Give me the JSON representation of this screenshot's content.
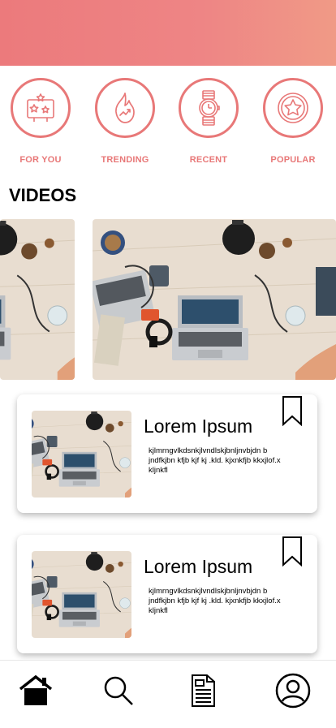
{
  "categories": [
    {
      "label": "FOR YOU",
      "icon": "stars-board-icon"
    },
    {
      "label": "TRENDING",
      "icon": "flame-trend-icon"
    },
    {
      "label": "RECENT",
      "icon": "watch-icon"
    },
    {
      "label": "POPULAR",
      "icon": "star-medal-icon"
    }
  ],
  "section": {
    "title": "VIDEOS"
  },
  "cards": [
    {
      "title": "Lorem Ipsum",
      "description": "kjlmrngvlkdsnkjlvndlskjbnljnvbjdn b jndfkjbn kfjb kjf kj .kld. kjxnkfjb kkxjlof.x kljnkfl"
    },
    {
      "title": "Lorem Ipsum",
      "description": "kjlmrngvlkdsnkjlvndlskjbnljnvbjdn b jndfkjbn kfjb kjf kj .kld. kjxnkfjb kkxjlof.x kljnkfl"
    }
  ],
  "nav": {
    "items": [
      "home-icon",
      "search-icon",
      "document-icon",
      "profile-icon"
    ]
  },
  "colors": {
    "accent": "#e87878",
    "header_start": "#ec7a7c",
    "header_end": "#f09a86"
  }
}
